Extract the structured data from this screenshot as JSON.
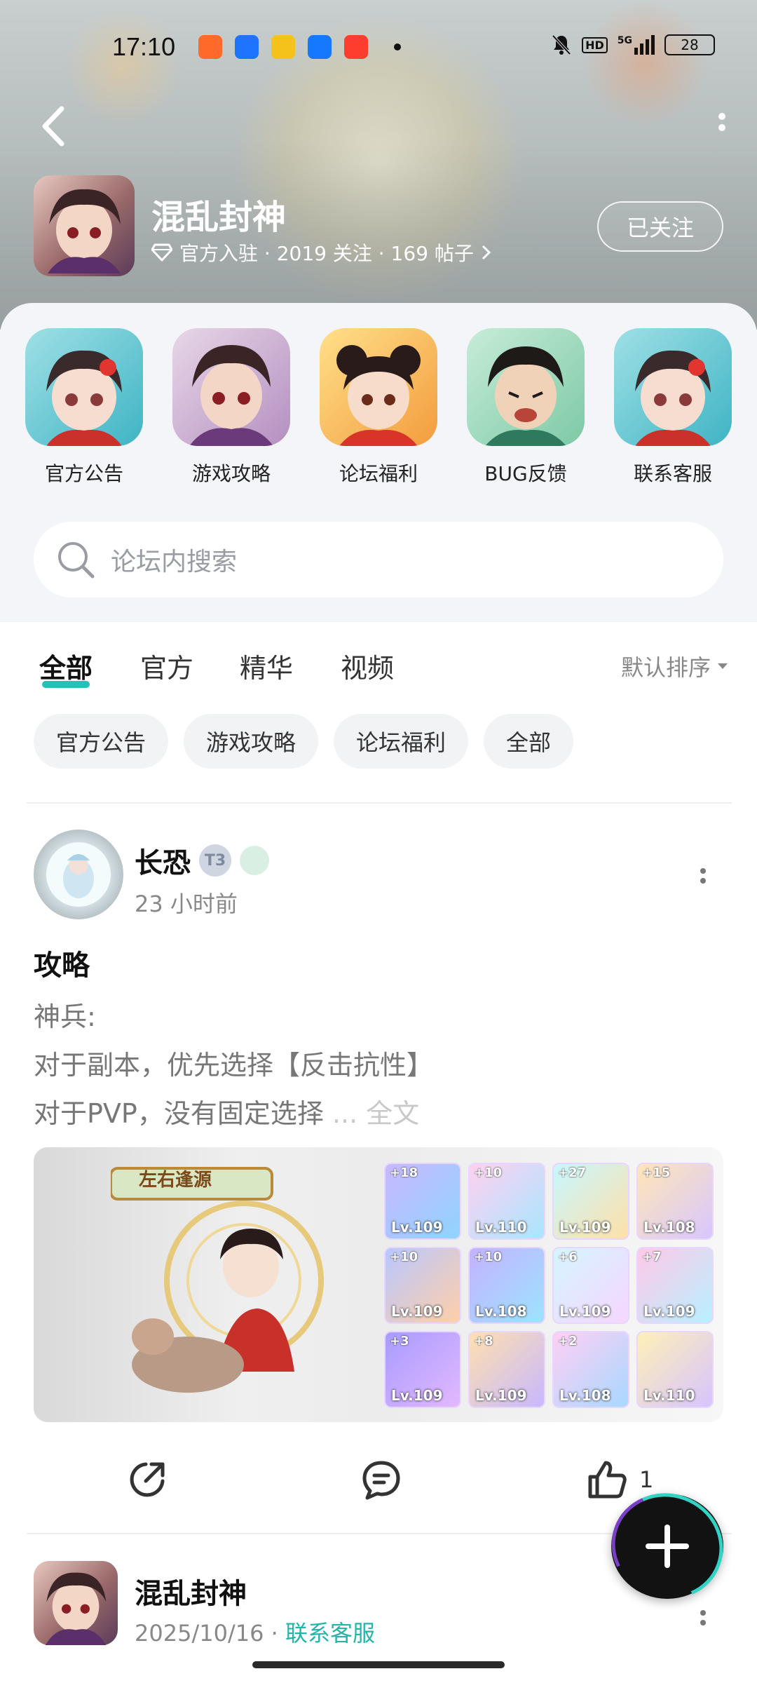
{
  "status_bar": {
    "time": "17:10",
    "network": "5G",
    "battery": "28",
    "hd": "HD"
  },
  "header": {
    "forum_title": "混乱封神",
    "meta": "官方入驻 · 2019 关注 · 169 帖子",
    "follow_label": "已关注"
  },
  "shortcuts": [
    {
      "label": "官方公告"
    },
    {
      "label": "游戏攻略"
    },
    {
      "label": "论坛福利"
    },
    {
      "label": "BUG反馈"
    },
    {
      "label": "联系客服"
    }
  ],
  "search": {
    "placeholder": "论坛内搜索"
  },
  "tabs": {
    "items": [
      "全部",
      "官方",
      "精华",
      "视频"
    ],
    "active": "全部",
    "sort_label": "默认排序"
  },
  "chips": [
    "官方公告",
    "游戏攻略",
    "论坛福利",
    "全部"
  ],
  "post1": {
    "author": "长恐",
    "level_badge": "T3",
    "time": "23 小时前",
    "title": "攻略",
    "body_lines": [
      "神兵:",
      "对于副本，优先选择【反击抗性】",
      "对于PVP，没有固定选择"
    ],
    "more_label": "... 全文",
    "image": {
      "banner": "左右逢源",
      "items": [
        {
          "plus": "+18",
          "lv": "Lv.109"
        },
        {
          "plus": "+10",
          "lv": "Lv.110"
        },
        {
          "plus": "+27",
          "lv": "Lv.109"
        },
        {
          "plus": "+15",
          "lv": "Lv.108"
        },
        {
          "plus": "+10",
          "lv": "Lv.109"
        },
        {
          "plus": "+10",
          "lv": "Lv.108"
        },
        {
          "plus": "+6",
          "lv": "Lv.109"
        },
        {
          "plus": "+7",
          "lv": "Lv.109"
        },
        {
          "plus": "+3",
          "lv": "Lv.109"
        },
        {
          "plus": "+8",
          "lv": "Lv.109"
        },
        {
          "plus": "+2",
          "lv": "Lv.108"
        },
        {
          "plus": "",
          "lv": "Lv.110"
        }
      ]
    },
    "like_count": "1"
  },
  "post2": {
    "author": "混乱封神",
    "date": "2025/10/16",
    "separator": "·",
    "tag": "联系客服"
  },
  "colors": {
    "accent": "#24c1b8",
    "tag_text": "#22b5a8"
  }
}
